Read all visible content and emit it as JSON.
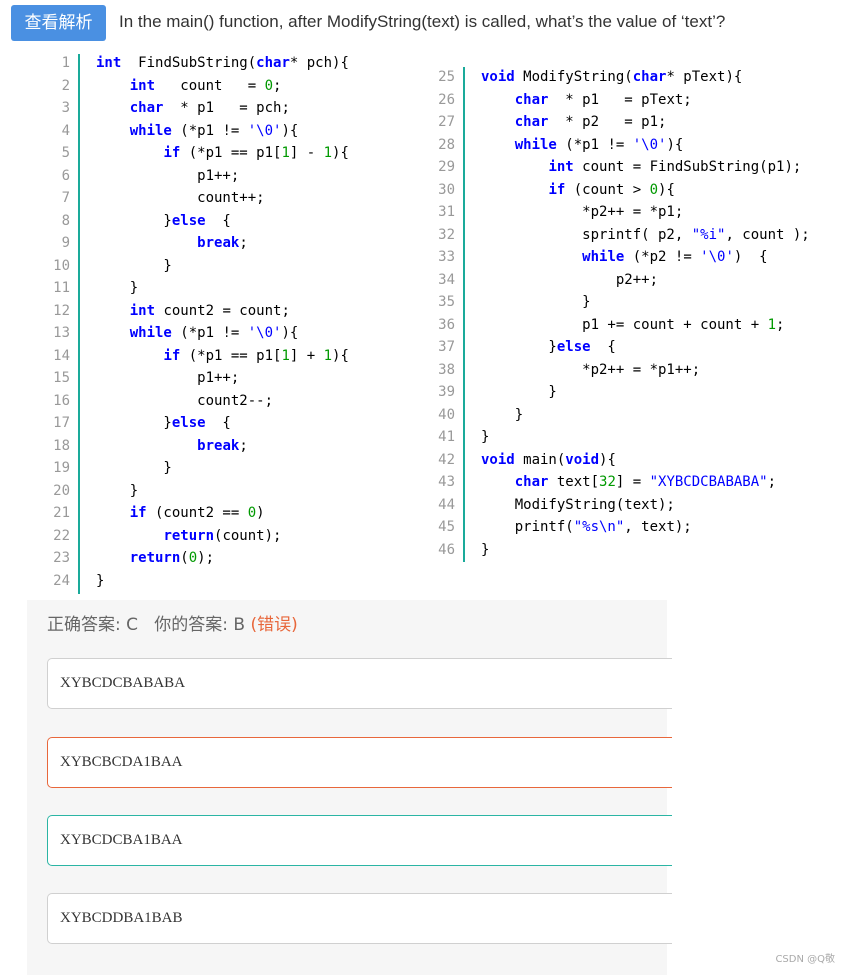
{
  "header": {
    "analysis_button": "查看解析",
    "question": "In the main() function, after ModifyString(text) is called, what’s the value of ‘text’?"
  },
  "code_left": [
    {
      "n": "1",
      "segs": [
        [
          "kw",
          "int"
        ],
        [
          "",
          "  FindSubString("
        ],
        [
          "kw",
          "char"
        ],
        [
          "",
          "* pch){"
        ]
      ]
    },
    {
      "n": "2",
      "segs": [
        [
          "",
          "    "
        ],
        [
          "kw",
          "int"
        ],
        [
          "",
          "   count   = "
        ],
        [
          "num",
          "0"
        ],
        [
          "",
          ";"
        ]
      ]
    },
    {
      "n": "3",
      "segs": [
        [
          "",
          "    "
        ],
        [
          "kw",
          "char"
        ],
        [
          "",
          "  * p1   = pch;"
        ]
      ]
    },
    {
      "n": "4",
      "segs": [
        [
          "",
          "    "
        ],
        [
          "kw",
          "while"
        ],
        [
          "",
          " (*p1 != "
        ],
        [
          "str",
          "'\\0'"
        ],
        [
          "",
          "){"
        ]
      ]
    },
    {
      "n": "5",
      "segs": [
        [
          "",
          "        "
        ],
        [
          "kw",
          "if"
        ],
        [
          "",
          " (*p1 == p1["
        ],
        [
          "num",
          "1"
        ],
        [
          "",
          "] - "
        ],
        [
          "num",
          "1"
        ],
        [
          "",
          "){"
        ]
      ]
    },
    {
      "n": "6",
      "segs": [
        [
          "",
          "            p1++;"
        ]
      ]
    },
    {
      "n": "7",
      "segs": [
        [
          "",
          "            count++;"
        ]
      ]
    },
    {
      "n": "8",
      "segs": [
        [
          "",
          "        }"
        ],
        [
          "kw",
          "else"
        ],
        [
          "",
          "  {"
        ]
      ]
    },
    {
      "n": "9",
      "segs": [
        [
          "",
          "            "
        ],
        [
          "kw",
          "break"
        ],
        [
          "",
          ";"
        ]
      ]
    },
    {
      "n": "10",
      "segs": [
        [
          "",
          "        }"
        ]
      ]
    },
    {
      "n": "11",
      "segs": [
        [
          "",
          "    }"
        ]
      ]
    },
    {
      "n": "12",
      "segs": [
        [
          "",
          "    "
        ],
        [
          "kw",
          "int"
        ],
        [
          "",
          " count2 = count;"
        ]
      ]
    },
    {
      "n": "13",
      "segs": [
        [
          "",
          "    "
        ],
        [
          "kw",
          "while"
        ],
        [
          "",
          " (*p1 != "
        ],
        [
          "str",
          "'\\0'"
        ],
        [
          "",
          "){"
        ]
      ]
    },
    {
      "n": "14",
      "segs": [
        [
          "",
          "        "
        ],
        [
          "kw",
          "if"
        ],
        [
          "",
          " (*p1 == p1["
        ],
        [
          "num",
          "1"
        ],
        [
          "",
          "] + "
        ],
        [
          "num",
          "1"
        ],
        [
          "",
          "){"
        ]
      ]
    },
    {
      "n": "15",
      "segs": [
        [
          "",
          "            p1++;"
        ]
      ]
    },
    {
      "n": "16",
      "segs": [
        [
          "",
          "            count2--;"
        ]
      ]
    },
    {
      "n": "17",
      "segs": [
        [
          "",
          "        }"
        ],
        [
          "kw",
          "else"
        ],
        [
          "",
          "  {"
        ]
      ]
    },
    {
      "n": "18",
      "segs": [
        [
          "",
          "            "
        ],
        [
          "kw",
          "break"
        ],
        [
          "",
          ";"
        ]
      ]
    },
    {
      "n": "19",
      "segs": [
        [
          "",
          "        }"
        ]
      ]
    },
    {
      "n": "20",
      "segs": [
        [
          "",
          "    }"
        ]
      ]
    },
    {
      "n": "21",
      "segs": [
        [
          "",
          "    "
        ],
        [
          "kw",
          "if"
        ],
        [
          "",
          " (count2 == "
        ],
        [
          "num",
          "0"
        ],
        [
          "",
          ")"
        ]
      ]
    },
    {
      "n": "22",
      "segs": [
        [
          "",
          "        "
        ],
        [
          "kw",
          "return"
        ],
        [
          "",
          "(count);"
        ]
      ]
    },
    {
      "n": "23",
      "segs": [
        [
          "",
          "    "
        ],
        [
          "kw",
          "return"
        ],
        [
          "",
          "("
        ],
        [
          "num",
          "0"
        ],
        [
          "",
          ");"
        ]
      ]
    },
    {
      "n": "24",
      "segs": [
        [
          "",
          "}"
        ]
      ]
    }
  ],
  "code_right": [
    {
      "n": "25",
      "segs": [
        [
          "kw",
          "void"
        ],
        [
          "",
          " ModifyString("
        ],
        [
          "kw",
          "char"
        ],
        [
          "",
          "* pText){"
        ]
      ]
    },
    {
      "n": "26",
      "segs": [
        [
          "",
          "    "
        ],
        [
          "kw",
          "char"
        ],
        [
          "",
          "  * p1   = pText;"
        ]
      ]
    },
    {
      "n": "27",
      "segs": [
        [
          "",
          "    "
        ],
        [
          "kw",
          "char"
        ],
        [
          "",
          "  * p2   = p1;"
        ]
      ]
    },
    {
      "n": "28",
      "segs": [
        [
          "",
          "    "
        ],
        [
          "kw",
          "while"
        ],
        [
          "",
          " (*p1 != "
        ],
        [
          "str",
          "'\\0'"
        ],
        [
          "",
          "){"
        ]
      ]
    },
    {
      "n": "29",
      "segs": [
        [
          "",
          "        "
        ],
        [
          "kw",
          "int"
        ],
        [
          "",
          " count = FindSubString(p1);"
        ]
      ]
    },
    {
      "n": "30",
      "segs": [
        [
          "",
          "        "
        ],
        [
          "kw",
          "if"
        ],
        [
          "",
          " (count > "
        ],
        [
          "num",
          "0"
        ],
        [
          "",
          "){"
        ]
      ]
    },
    {
      "n": "31",
      "segs": [
        [
          "",
          "            *p2++ = *p1;"
        ]
      ]
    },
    {
      "n": "32",
      "segs": [
        [
          "",
          "            sprintf( p2, "
        ],
        [
          "str",
          "\"%i\""
        ],
        [
          "",
          ", count );"
        ]
      ]
    },
    {
      "n": "33",
      "segs": [
        [
          "",
          "            "
        ],
        [
          "kw",
          "while"
        ],
        [
          "",
          " (*p2 != "
        ],
        [
          "str",
          "'\\0'"
        ],
        [
          "",
          ")  {"
        ]
      ]
    },
    {
      "n": "34",
      "segs": [
        [
          "",
          "                p2++;"
        ]
      ]
    },
    {
      "n": "35",
      "segs": [
        [
          "",
          "            }"
        ]
      ]
    },
    {
      "n": "36",
      "segs": [
        [
          "",
          "            p1 += count + count + "
        ],
        [
          "num",
          "1"
        ],
        [
          "",
          ";"
        ]
      ]
    },
    {
      "n": "37",
      "segs": [
        [
          "",
          "        }"
        ],
        [
          "kw",
          "else"
        ],
        [
          "",
          "  {"
        ]
      ]
    },
    {
      "n": "38",
      "segs": [
        [
          "",
          "            *p2++ = *p1++;"
        ]
      ]
    },
    {
      "n": "39",
      "segs": [
        [
          "",
          "        }"
        ]
      ]
    },
    {
      "n": "40",
      "segs": [
        [
          "",
          "    }"
        ]
      ]
    },
    {
      "n": "41",
      "segs": [
        [
          "",
          "}"
        ]
      ]
    },
    {
      "n": "42",
      "segs": [
        [
          "kw",
          "void"
        ],
        [
          "",
          " main("
        ],
        [
          "kw",
          "void"
        ],
        [
          "",
          "){"
        ]
      ]
    },
    {
      "n": "43",
      "segs": [
        [
          "",
          "    "
        ],
        [
          "kw",
          "char"
        ],
        [
          "",
          " text["
        ],
        [
          "num",
          "32"
        ],
        [
          "",
          "] = "
        ],
        [
          "str",
          "\"XYBCDCBABABA\""
        ],
        [
          "",
          ";"
        ]
      ]
    },
    {
      "n": "44",
      "segs": [
        [
          "",
          "    ModifyString(text);"
        ]
      ]
    },
    {
      "n": "45",
      "segs": [
        [
          "",
          "    printf("
        ],
        [
          "str",
          "\"%s\\n\""
        ],
        [
          "",
          ", text);"
        ]
      ]
    },
    {
      "n": "46",
      "segs": [
        [
          "",
          "}"
        ]
      ]
    }
  ],
  "answer": {
    "correct_label": "正确答案: C",
    "yours_label": "你的答案: B",
    "verdict": "(错误)"
  },
  "options": [
    {
      "text": "XYBCDCBABABA",
      "state": "normal"
    },
    {
      "text": "XYBCBCDA1BAA",
      "state": "selected-wrong"
    },
    {
      "text": "XYBCDCBA1BAA",
      "state": "correct"
    },
    {
      "text": "XYBCDDBA1BAB",
      "state": "normal"
    }
  ],
  "watermark": "CSDN @Q敬",
  "colors": {
    "accent": "#4a90e2",
    "keyword": "#0000ff",
    "number": "#009900",
    "wrong": "#e8673b",
    "correct": "#2bb5a4"
  }
}
